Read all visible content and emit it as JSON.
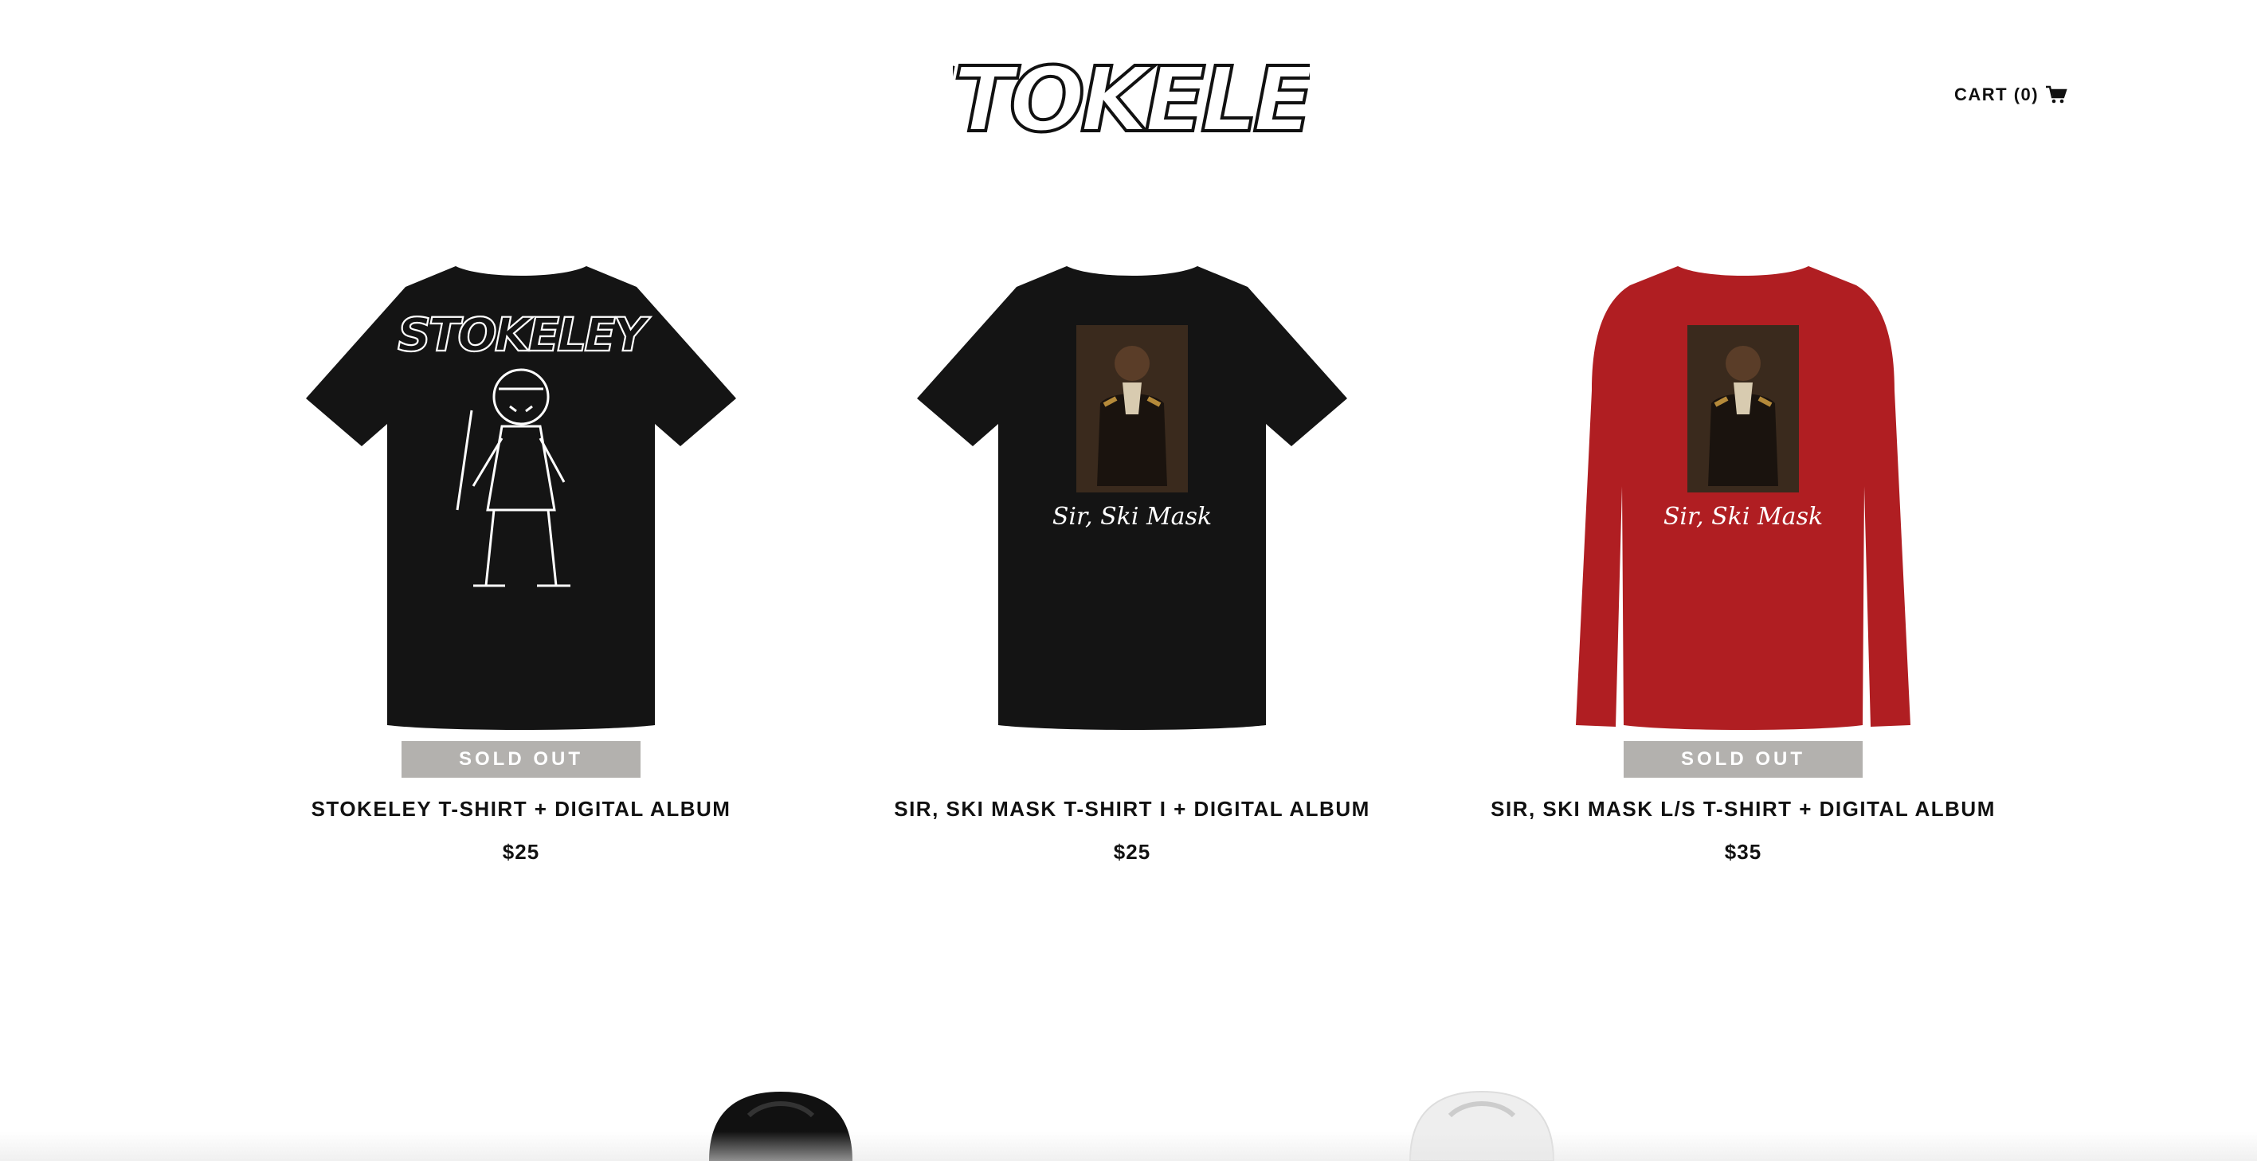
{
  "header": {
    "logo_text": "STOKELEY",
    "cart_label": "CART (0)",
    "cart_icon": "cart-icon"
  },
  "products": [
    {
      "title": "STOKELEY T-SHIRT + DIGITAL ALBUM",
      "price": "$25",
      "badge": "SOLD OUT",
      "graphic_text": "STOKELEY",
      "color": "#141414"
    },
    {
      "title": "SIR, SKI MASK T-SHIRT I + DIGITAL ALBUM",
      "price": "$25",
      "badge": "",
      "graphic_text": "Sir, Ski Mask",
      "color": "#141414"
    },
    {
      "title": "SIR, SKI MASK L/S T-SHIRT + DIGITAL ALBUM",
      "price": "$35",
      "badge": "SOLD OUT",
      "graphic_text": "Sir, Ski Mask",
      "color": "#b01e22"
    }
  ],
  "row2": [
    {
      "color": "#111111"
    },
    {
      "color": "#eeeeee"
    }
  ]
}
